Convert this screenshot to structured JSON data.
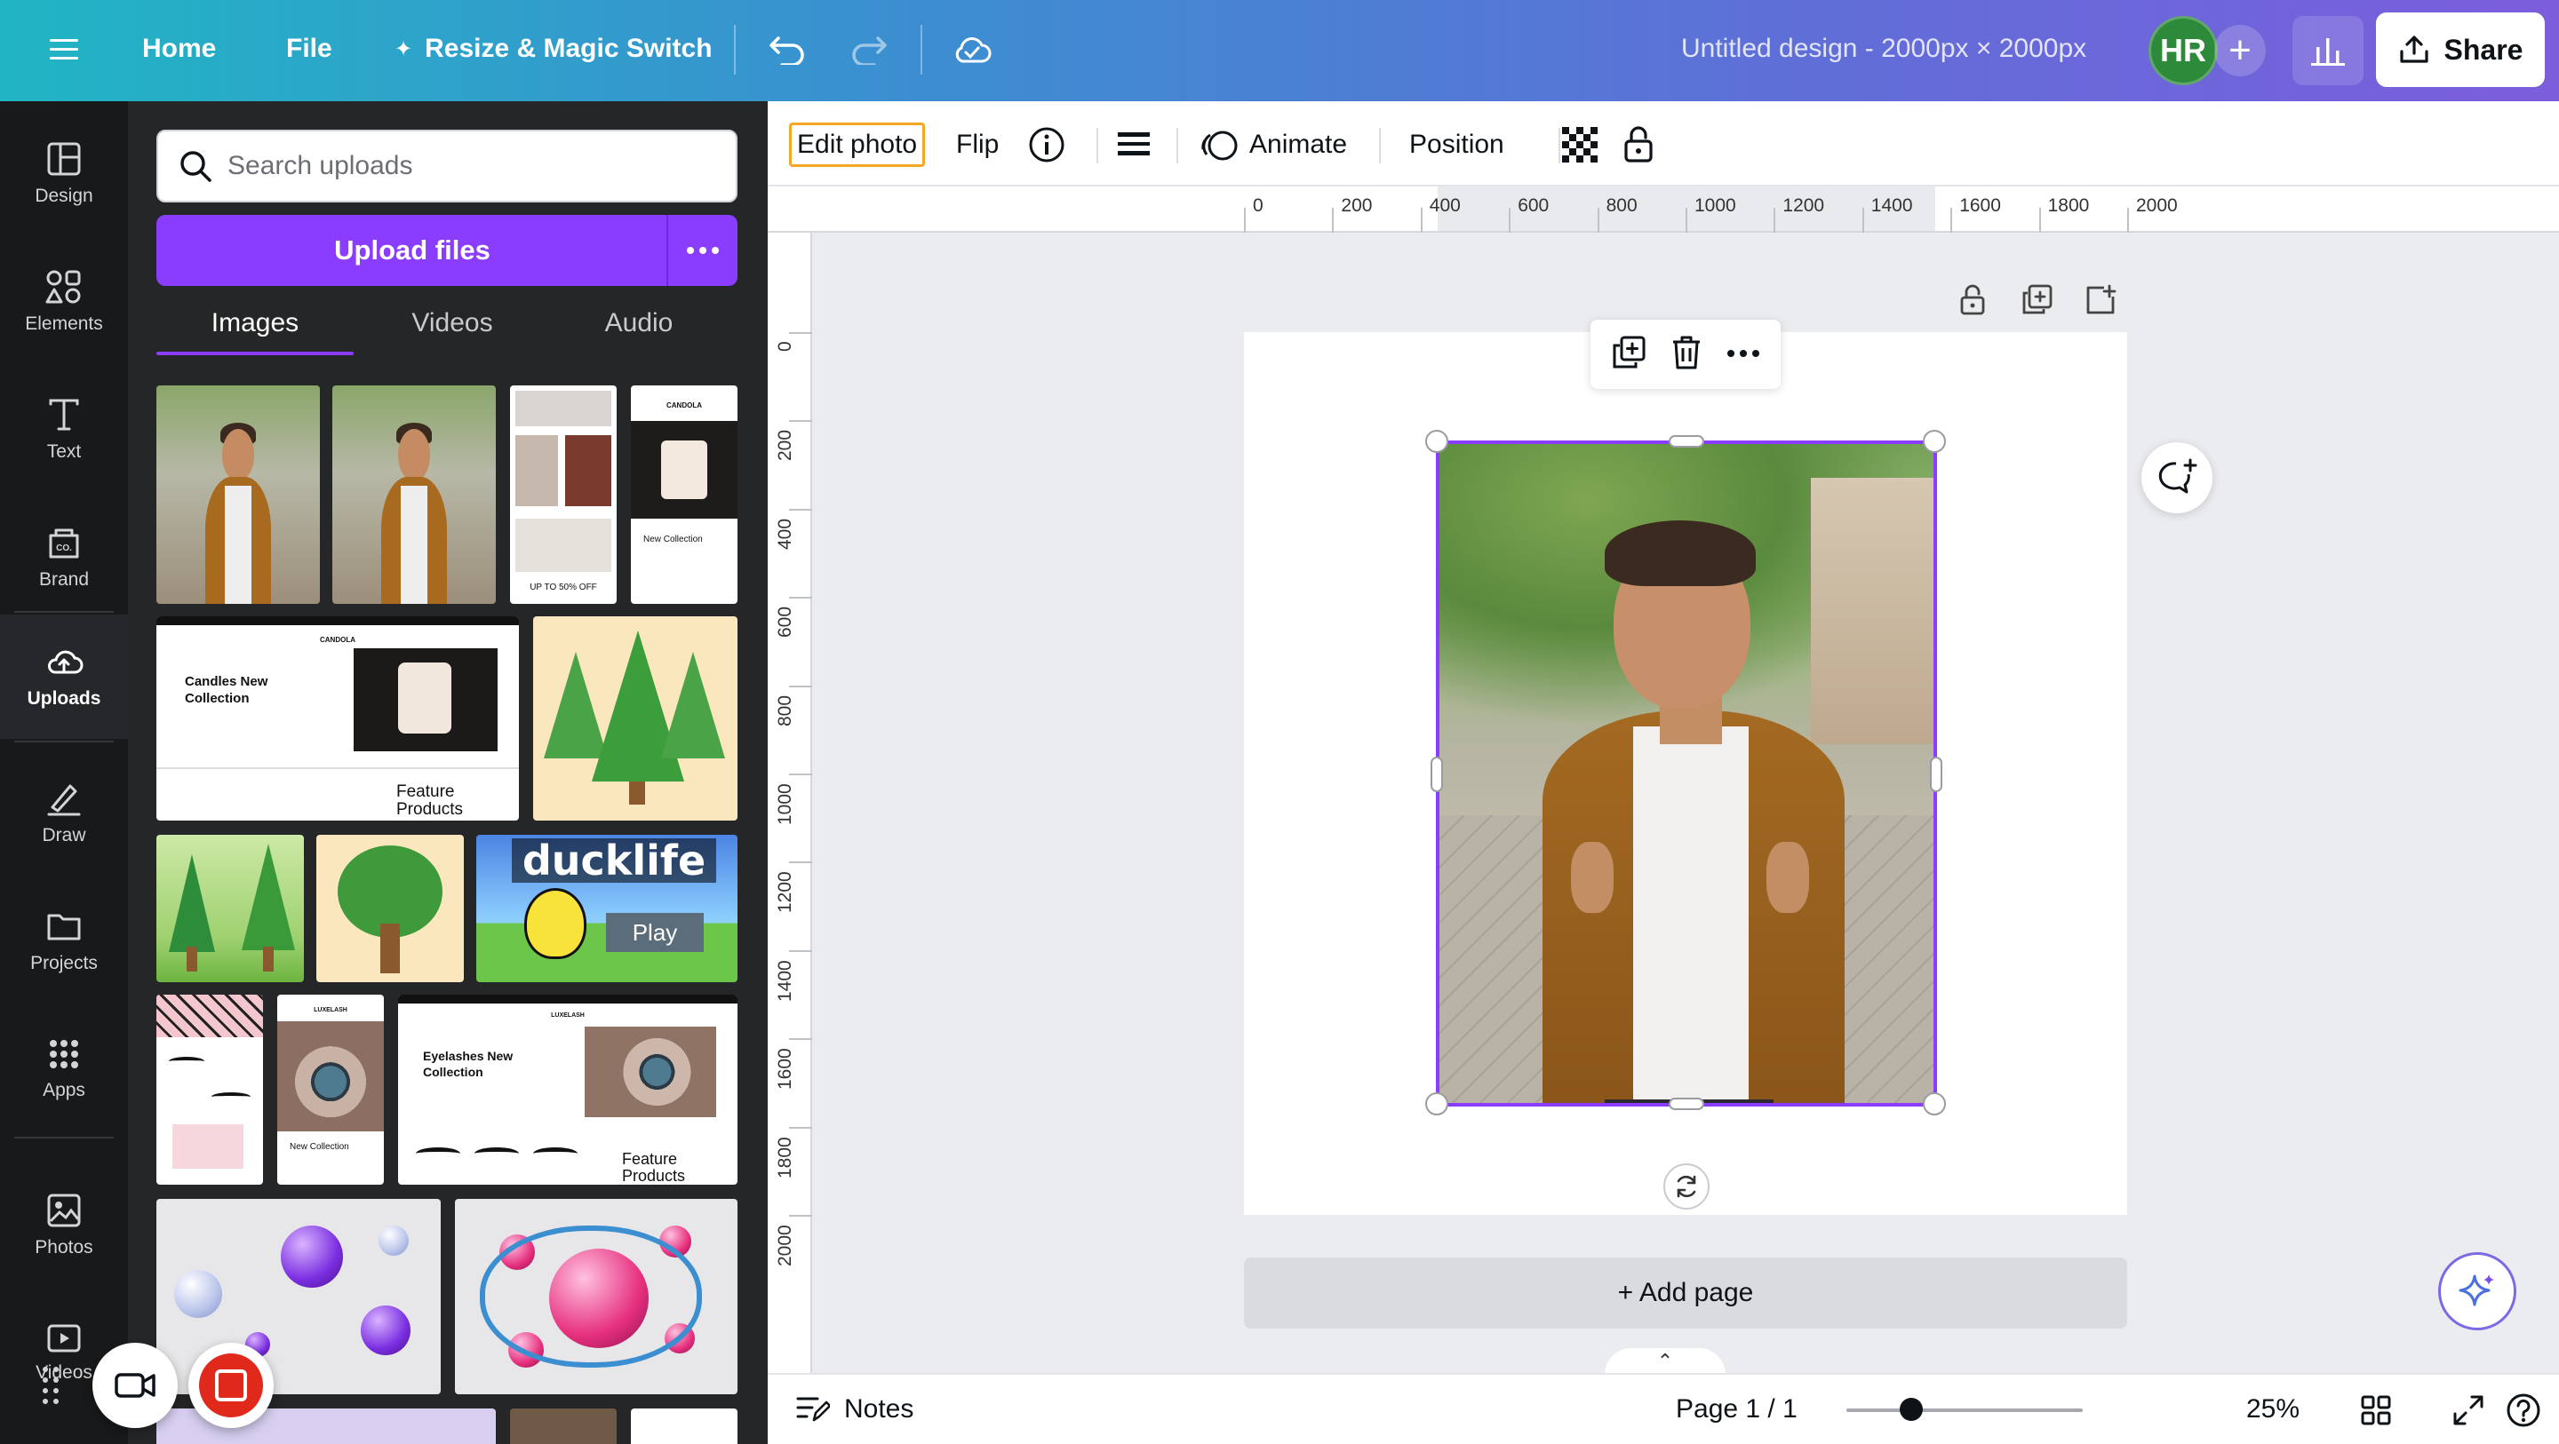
{
  "topbar": {
    "home": "Home",
    "file": "File",
    "resize": "Resize & Magic Switch",
    "doc_title": "Untitled design - 2000px × 2000px",
    "avatar_initials": "HR",
    "share": "Share"
  },
  "rail": {
    "items": [
      {
        "label": "Design",
        "icon": "design-icon"
      },
      {
        "label": "Elements",
        "icon": "elements-icon"
      },
      {
        "label": "Text",
        "icon": "text-icon"
      },
      {
        "label": "Brand",
        "icon": "brand-icon"
      },
      {
        "label": "Uploads",
        "icon": "upload-cloud-icon",
        "active": true
      },
      {
        "label": "Draw",
        "icon": "draw-icon"
      },
      {
        "label": "Projects",
        "icon": "folder-icon"
      },
      {
        "label": "Apps",
        "icon": "apps-grid-icon"
      },
      {
        "label": "Photos",
        "icon": "image-icon"
      },
      {
        "label": "Videos",
        "icon": "video-icon"
      }
    ]
  },
  "panel": {
    "search_placeholder": "Search uploads",
    "upload_button": "Upload files",
    "tabs": [
      {
        "label": "Images",
        "active": true
      },
      {
        "label": "Videos",
        "active": false
      },
      {
        "label": "Audio",
        "active": false
      }
    ],
    "thumb_texts": {
      "candola_title": "Candles New Collection",
      "candola_feature": "Feature Products",
      "candola_brand": "CANDOLA",
      "candola_sale": "UP TO 50% OFF",
      "candola_new": "New Collection",
      "duck_title": "ducklife",
      "duck_play": "Play",
      "lash_brand": "LUXELASH",
      "lash_title": "Eyelashes New Collection",
      "lash_feature": "Feature Products",
      "lash_new": "New Collection"
    }
  },
  "context_toolbar": {
    "edit_photo": "Edit photo",
    "flip": "Flip",
    "animate": "Animate",
    "position": "Position"
  },
  "ruler": {
    "top_labels": [
      "0",
      "200",
      "400",
      "600",
      "800",
      "1000",
      "1200",
      "1400",
      "1600",
      "1800",
      "2000"
    ],
    "left_labels": [
      "0",
      "200",
      "400",
      "600",
      "800",
      "1000",
      "1200",
      "1400",
      "1600",
      "1800",
      "2000"
    ]
  },
  "canvas": {
    "add_page": "+ Add page"
  },
  "footer": {
    "notes": "Notes",
    "page_indicator": "Page 1 / 1",
    "zoom": "25%",
    "zoom_fraction": 0.25
  },
  "colors": {
    "accent": "#8b3dff",
    "topbar_start": "#21b5c4",
    "topbar_end": "#7c5ddc",
    "selection_border": "#8b3dff",
    "edit_photo_outline": "#f5a623"
  }
}
